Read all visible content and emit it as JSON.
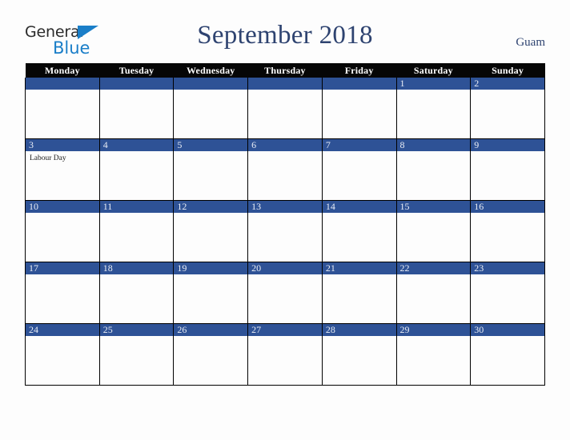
{
  "brand": {
    "name_part1": "General",
    "name_part2": "Blue",
    "triangle_color": "#1a7ec8",
    "text_color": "#2b2b2b"
  },
  "header": {
    "title": "September 2018",
    "locale": "Guam",
    "title_color": "#2e4370"
  },
  "calendar": {
    "weekday_headers": [
      "Monday",
      "Tuesday",
      "Wednesday",
      "Thursday",
      "Friday",
      "Saturday",
      "Sunday"
    ],
    "header_bg": "#060606",
    "header_text": "#ffffff",
    "daynum_band_color": "#2e5296",
    "daynum_text_color": "#e9edf5",
    "cell_bg": "#fdfdfd",
    "border_color": "#000000",
    "weeks": [
      [
        {
          "day": "",
          "events": []
        },
        {
          "day": "",
          "events": []
        },
        {
          "day": "",
          "events": []
        },
        {
          "day": "",
          "events": []
        },
        {
          "day": "",
          "events": []
        },
        {
          "day": "1",
          "events": []
        },
        {
          "day": "2",
          "events": []
        }
      ],
      [
        {
          "day": "3",
          "events": [
            "Labour Day"
          ]
        },
        {
          "day": "4",
          "events": []
        },
        {
          "day": "5",
          "events": []
        },
        {
          "day": "6",
          "events": []
        },
        {
          "day": "7",
          "events": []
        },
        {
          "day": "8",
          "events": []
        },
        {
          "day": "9",
          "events": []
        }
      ],
      [
        {
          "day": "10",
          "events": []
        },
        {
          "day": "11",
          "events": []
        },
        {
          "day": "12",
          "events": []
        },
        {
          "day": "13",
          "events": []
        },
        {
          "day": "14",
          "events": []
        },
        {
          "day": "15",
          "events": []
        },
        {
          "day": "16",
          "events": []
        }
      ],
      [
        {
          "day": "17",
          "events": []
        },
        {
          "day": "18",
          "events": []
        },
        {
          "day": "19",
          "events": []
        },
        {
          "day": "20",
          "events": []
        },
        {
          "day": "21",
          "events": []
        },
        {
          "day": "22",
          "events": []
        },
        {
          "day": "23",
          "events": []
        }
      ],
      [
        {
          "day": "24",
          "events": []
        },
        {
          "day": "25",
          "events": []
        },
        {
          "day": "26",
          "events": []
        },
        {
          "day": "27",
          "events": []
        },
        {
          "day": "28",
          "events": []
        },
        {
          "day": "29",
          "events": []
        },
        {
          "day": "30",
          "events": []
        }
      ]
    ]
  }
}
